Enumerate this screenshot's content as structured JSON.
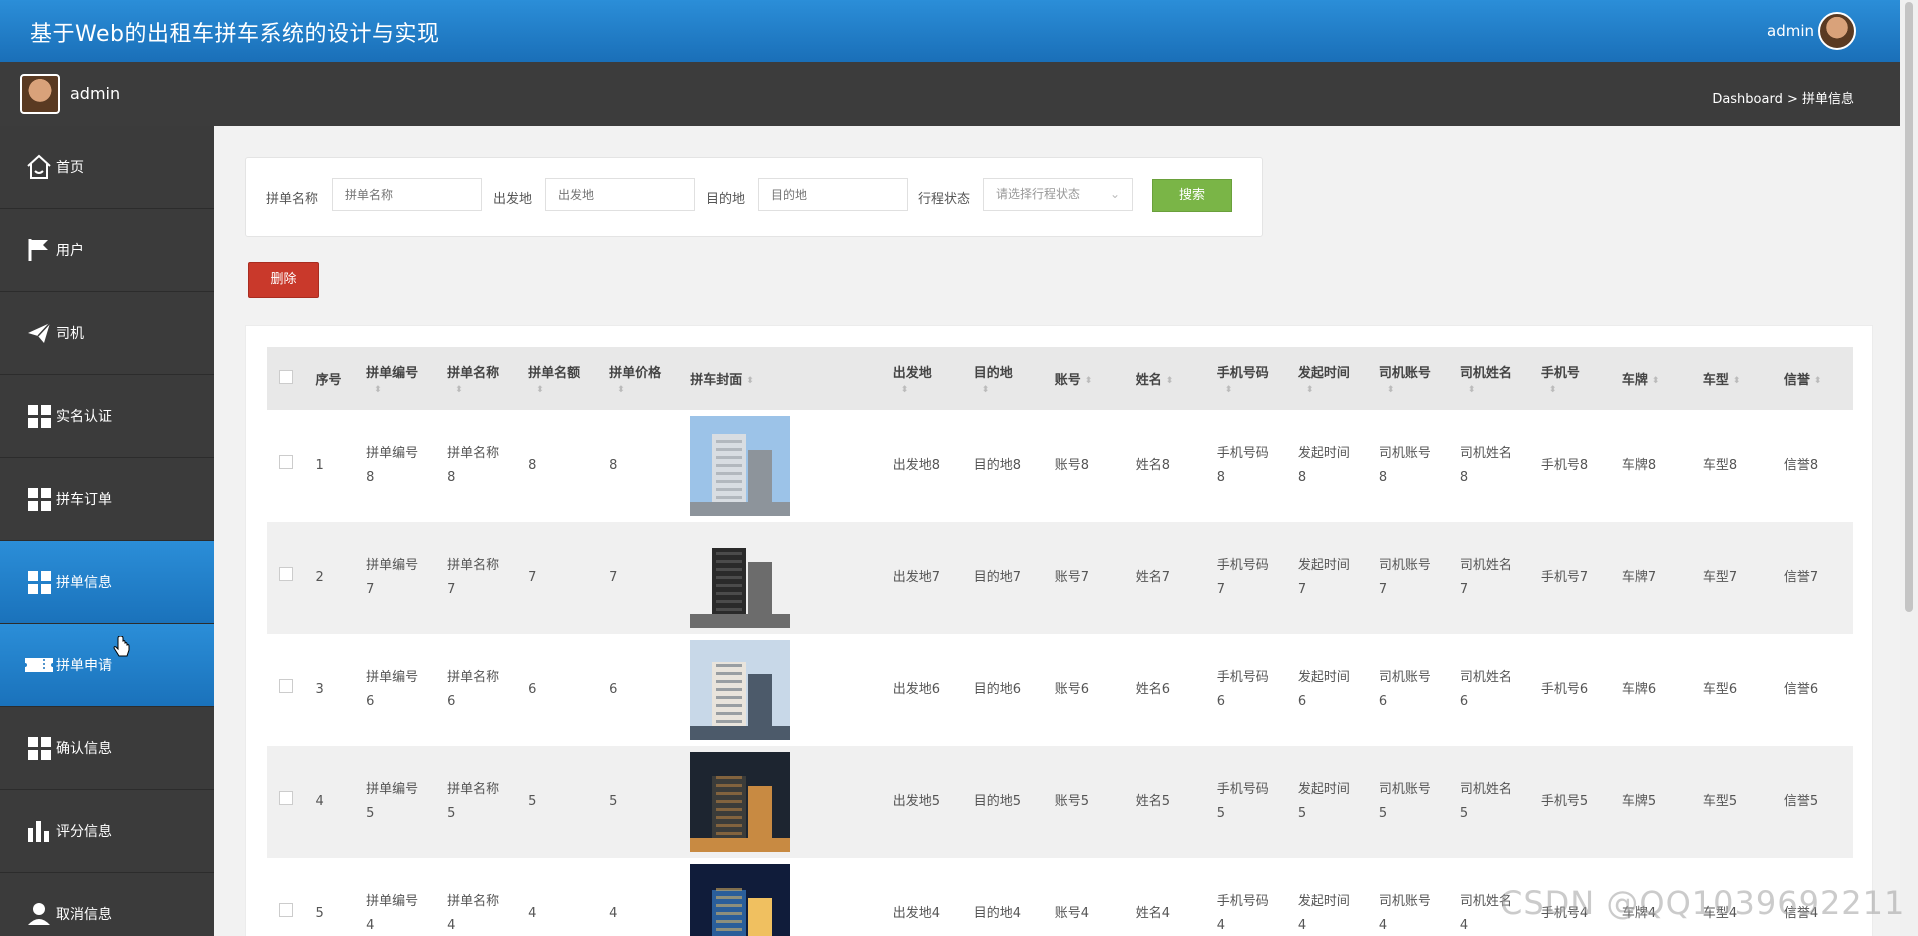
{
  "app": {
    "title": "基于Web的出租车拼车系统的设计与实现",
    "user": "admin"
  },
  "subbar": {
    "user": "admin",
    "breadcrumb": "Dashboard > 拼单信息"
  },
  "sidebar": {
    "items": [
      {
        "label": "首页",
        "icon": "home-icon"
      },
      {
        "label": "用户",
        "icon": "flag-icon"
      },
      {
        "label": "司机",
        "icon": "paper-plane-icon"
      },
      {
        "label": "实名认证",
        "icon": "grid-icon"
      },
      {
        "label": "拼车订单",
        "icon": "grid-icon"
      },
      {
        "label": "拼单信息",
        "icon": "grid-icon",
        "active": true
      },
      {
        "label": "拼单申请",
        "icon": "ticket-icon",
        "active": true
      },
      {
        "label": "确认信息",
        "icon": "grid-icon"
      },
      {
        "label": "评分信息",
        "icon": "bar-chart-icon"
      },
      {
        "label": "取消信息",
        "icon": "user-icon"
      }
    ]
  },
  "search": {
    "name_label": "拼单名称",
    "name_placeholder": "拼单名称",
    "from_label": "出发地",
    "from_placeholder": "出发地",
    "to_label": "目的地",
    "to_placeholder": "目的地",
    "status_label": "行程状态",
    "status_placeholder": "请选择行程状态",
    "button": "搜索"
  },
  "actions": {
    "delete": "删除"
  },
  "table": {
    "headers": [
      "序号",
      "拼单编号",
      "拼单名称",
      "拼单名额",
      "拼单价格",
      "拼车封面",
      "出发地",
      "目的地",
      "账号",
      "姓名",
      "手机号码",
      "发起时间",
      "司机账号",
      "司机姓名",
      "手机号",
      "车牌",
      "车型",
      "信誉"
    ],
    "rows": [
      {
        "idx": "1",
        "code": [
          "拼单编号",
          "8"
        ],
        "name": [
          "拼单名称",
          "8"
        ],
        "quota": "8",
        "price": "8",
        "from": "出发地8",
        "to": "目的地8",
        "account": "账号8",
        "uname": "姓名8",
        "phone": [
          "手机号码",
          "8"
        ],
        "time": [
          "发起时间",
          "8"
        ],
        "dacc": [
          "司机账号",
          "8"
        ],
        "dname": [
          "司机姓名",
          "8"
        ],
        "dphone": "手机号8",
        "plate": "车牌8",
        "model": "车型8",
        "credit": "信誉8"
      },
      {
        "idx": "2",
        "code": [
          "拼单编号",
          "7"
        ],
        "name": [
          "拼单名称",
          "7"
        ],
        "quota": "7",
        "price": "7",
        "from": "出发地7",
        "to": "目的地7",
        "account": "账号7",
        "uname": "姓名7",
        "phone": [
          "手机号码",
          "7"
        ],
        "time": [
          "发起时间",
          "7"
        ],
        "dacc": [
          "司机账号",
          "7"
        ],
        "dname": [
          "司机姓名",
          "7"
        ],
        "dphone": "手机号7",
        "plate": "车牌7",
        "model": "车型7",
        "credit": "信誉7"
      },
      {
        "idx": "3",
        "code": [
          "拼单编号",
          "6"
        ],
        "name": [
          "拼单名称",
          "6"
        ],
        "quota": "6",
        "price": "6",
        "from": "出发地6",
        "to": "目的地6",
        "account": "账号6",
        "uname": "姓名6",
        "phone": [
          "手机号码",
          "6"
        ],
        "time": [
          "发起时间",
          "6"
        ],
        "dacc": [
          "司机账号",
          "6"
        ],
        "dname": [
          "司机姓名",
          "6"
        ],
        "dphone": "手机号6",
        "plate": "车牌6",
        "model": "车型6",
        "credit": "信誉6"
      },
      {
        "idx": "4",
        "code": [
          "拼单编号",
          "5"
        ],
        "name": [
          "拼单名称",
          "5"
        ],
        "quota": "5",
        "price": "5",
        "from": "出发地5",
        "to": "目的地5",
        "account": "账号5",
        "uname": "姓名5",
        "phone": [
          "手机号码",
          "5"
        ],
        "time": [
          "发起时间",
          "5"
        ],
        "dacc": [
          "司机账号",
          "5"
        ],
        "dname": [
          "司机姓名",
          "5"
        ],
        "dphone": "手机号5",
        "plate": "车牌5",
        "model": "车型5",
        "credit": "信誉5"
      },
      {
        "idx": "5",
        "code": [
          "拼单编号",
          "4"
        ],
        "name": [
          "拼单名称",
          "4"
        ],
        "quota": "4",
        "price": "4",
        "from": "出发地4",
        "to": "目的地4",
        "account": "账号4",
        "uname": "姓名4",
        "phone": [
          "手机号码",
          "4"
        ],
        "time": [
          "发起时间",
          "4"
        ],
        "dacc": [
          "司机账号",
          "4"
        ],
        "dname": [
          "司机姓名",
          "4"
        ],
        "dphone": "手机号4",
        "plate": "车牌4",
        "model": "车型4",
        "credit": "信誉4"
      }
    ]
  },
  "watermark": "CSDN @QQ1039692211",
  "colors": {
    "header_blue": "#1f7cc8",
    "sidebar": "#3b3b3b",
    "search_green": "#7ab547",
    "delete_red": "#c9392b"
  }
}
